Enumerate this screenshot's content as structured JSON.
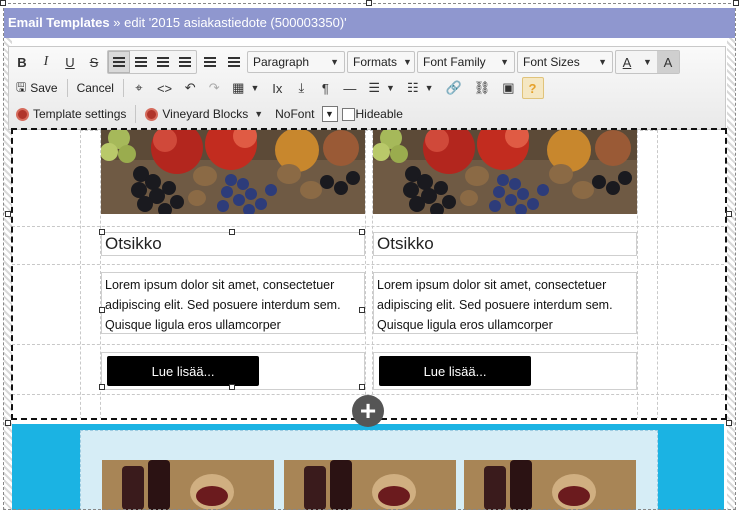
{
  "window": {
    "breadcrumb_root": "Email Templates",
    "breadcrumb_sep": "»",
    "breadcrumb_current": "edit '2015 asiakastiedote (500003350)'"
  },
  "toolbar": {
    "row1": {
      "bold": "B",
      "italic": "I",
      "underline": "U",
      "strikethrough": "S",
      "block_format": "Paragraph",
      "formats": "Formats",
      "font_family": "Font Family",
      "font_sizes": "Font Sizes",
      "text_color": "A",
      "bg_color": "A"
    },
    "row2": {
      "save": "Save",
      "cancel": "Cancel"
    },
    "row3": {
      "template_settings": "Template settings",
      "vineyard_blocks": "Vineyard Blocks",
      "nofont": "NoFont",
      "hideable": "Hideable"
    }
  },
  "cards": [
    {
      "headline": "Otsikko",
      "body": "Lorem ipsum dolor sit amet, consectetuer adipiscing elit. Sed posuere interdum sem. Quisque ligula eros ullamcorper",
      "button": "Lue lisää..."
    },
    {
      "headline": "Otsikko",
      "body": "Lorem ipsum dolor sit amet, consectetuer adipiscing elit. Sed posuere interdum sem. Quisque ligula eros ullamcorper",
      "button": "Lue lisää..."
    }
  ],
  "icons": {
    "add_section": "plus-circle-icon",
    "template_settings": "vineyard-logo-icon"
  },
  "colors": {
    "titlebar": "#8f97cf",
    "blue_section": "#1bb3e3",
    "button_bg": "#000000"
  }
}
